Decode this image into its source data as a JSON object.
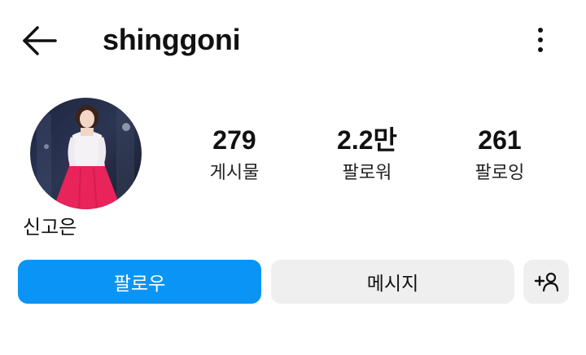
{
  "header": {
    "username": "shinggoni",
    "back_icon": "arrow-left-icon",
    "more_icon": "more-vertical-icon"
  },
  "profile": {
    "full_name": "신고은",
    "avatar": "profile-photo"
  },
  "stats": [
    {
      "value": "279",
      "label": "게시물"
    },
    {
      "value": "2.2만",
      "label": "팔로워"
    },
    {
      "value": "261",
      "label": "팔로잉"
    }
  ],
  "actions": {
    "follow_label": "팔로우",
    "message_label": "메시지",
    "suggest_icon": "add-person-icon"
  },
  "colors": {
    "accent": "#0a95f6",
    "secondary_button": "#efefef"
  }
}
